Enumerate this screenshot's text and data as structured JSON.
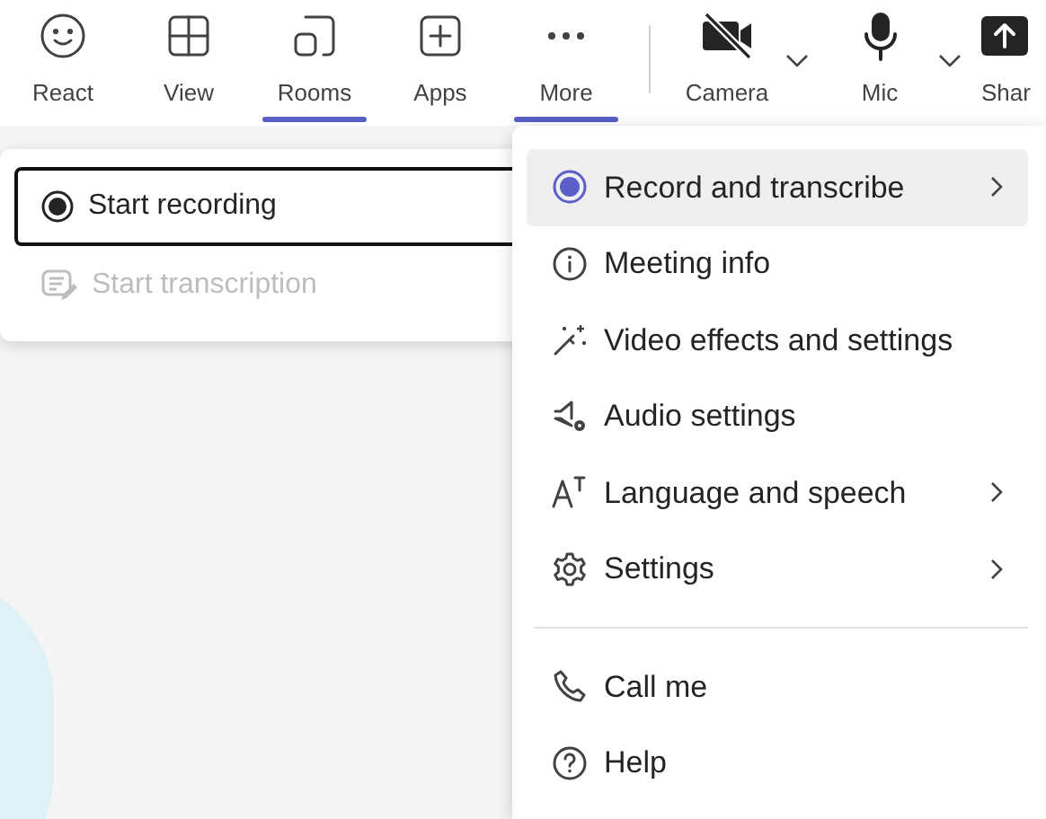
{
  "toolbar": [
    {
      "kind": "button",
      "label": "React",
      "selected": false
    },
    {
      "kind": "button",
      "label": "View",
      "selected": false
    },
    {
      "kind": "button",
      "label": "Rooms",
      "selected": true
    },
    {
      "kind": "button",
      "label": "Apps",
      "selected": false
    },
    {
      "kind": "button",
      "label": "More",
      "selected": true
    },
    {
      "kind": "split",
      "label": "Camera",
      "selected": false
    },
    {
      "kind": "split",
      "label": "Mic",
      "selected": false
    },
    {
      "kind": "button",
      "label": "Shar",
      "selected": false
    }
  ],
  "submenu": [
    {
      "label": "Start recording",
      "focused": true,
      "disabled": false
    },
    {
      "label": "Start transcription",
      "focused": false,
      "disabled": true
    }
  ],
  "menu": [
    {
      "kind": "item",
      "label": "Record and transcribe",
      "selected": true,
      "submenu": true
    },
    {
      "kind": "item",
      "label": "Meeting info",
      "selected": false,
      "submenu": false
    },
    {
      "kind": "item",
      "label": "Video effects and settings",
      "selected": false,
      "submenu": false
    },
    {
      "kind": "item",
      "label": "Audio settings",
      "selected": false,
      "submenu": false
    },
    {
      "kind": "item",
      "label": "Language and speech",
      "selected": false,
      "submenu": true
    },
    {
      "kind": "item",
      "label": "Settings",
      "selected": false,
      "submenu": true
    },
    {
      "kind": "divider"
    },
    {
      "kind": "item",
      "label": "Call me",
      "selected": false,
      "submenu": false
    },
    {
      "kind": "item",
      "label": "Help",
      "selected": false,
      "submenu": false
    }
  ]
}
